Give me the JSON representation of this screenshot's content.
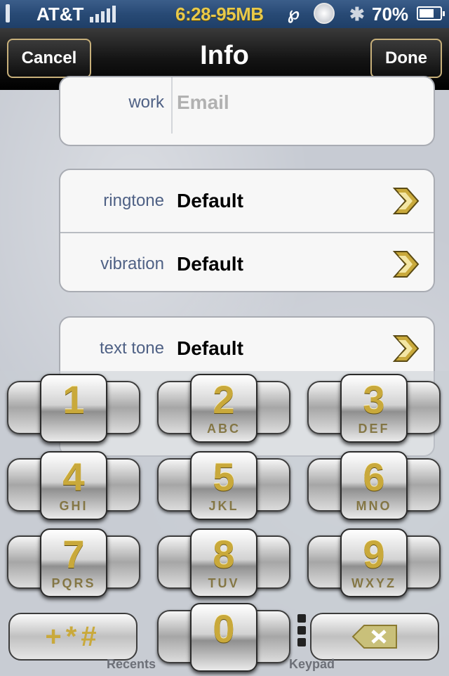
{
  "status_bar": {
    "carrier": "AT&T",
    "time_memory": "6:28-95MB",
    "p_glyph": "℘",
    "bluetooth_glyph": "✱",
    "battery": "70%"
  },
  "nav": {
    "title": "Info",
    "cancel": "Cancel",
    "done": "Done"
  },
  "fields": {
    "email": {
      "label": "work",
      "placeholder": "Email"
    },
    "ringtone": {
      "label": "ringtone",
      "value": "Default"
    },
    "vibration": {
      "label": "vibration",
      "value": "Default"
    },
    "text_tone": {
      "label": "text tone",
      "value": "Default"
    }
  },
  "keypad": {
    "keys": [
      {
        "num": "1",
        "letters": ""
      },
      {
        "num": "2",
        "letters": "ABC"
      },
      {
        "num": "3",
        "letters": "DEF"
      },
      {
        "num": "4",
        "letters": "GHI"
      },
      {
        "num": "5",
        "letters": "JKL"
      },
      {
        "num": "6",
        "letters": "MNO"
      },
      {
        "num": "7",
        "letters": "PQRS"
      },
      {
        "num": "8",
        "letters": "TUV"
      },
      {
        "num": "9",
        "letters": "WXYZ"
      },
      {
        "num": "0",
        "letters": ""
      }
    ],
    "symbols": "+*#"
  },
  "tab_labels": {
    "recents": "Recents",
    "keypad": "Keypad"
  },
  "colors": {
    "accent_gold": "#c9a93b",
    "label_blue": "#4f6185",
    "status_bar": "#284a75"
  }
}
